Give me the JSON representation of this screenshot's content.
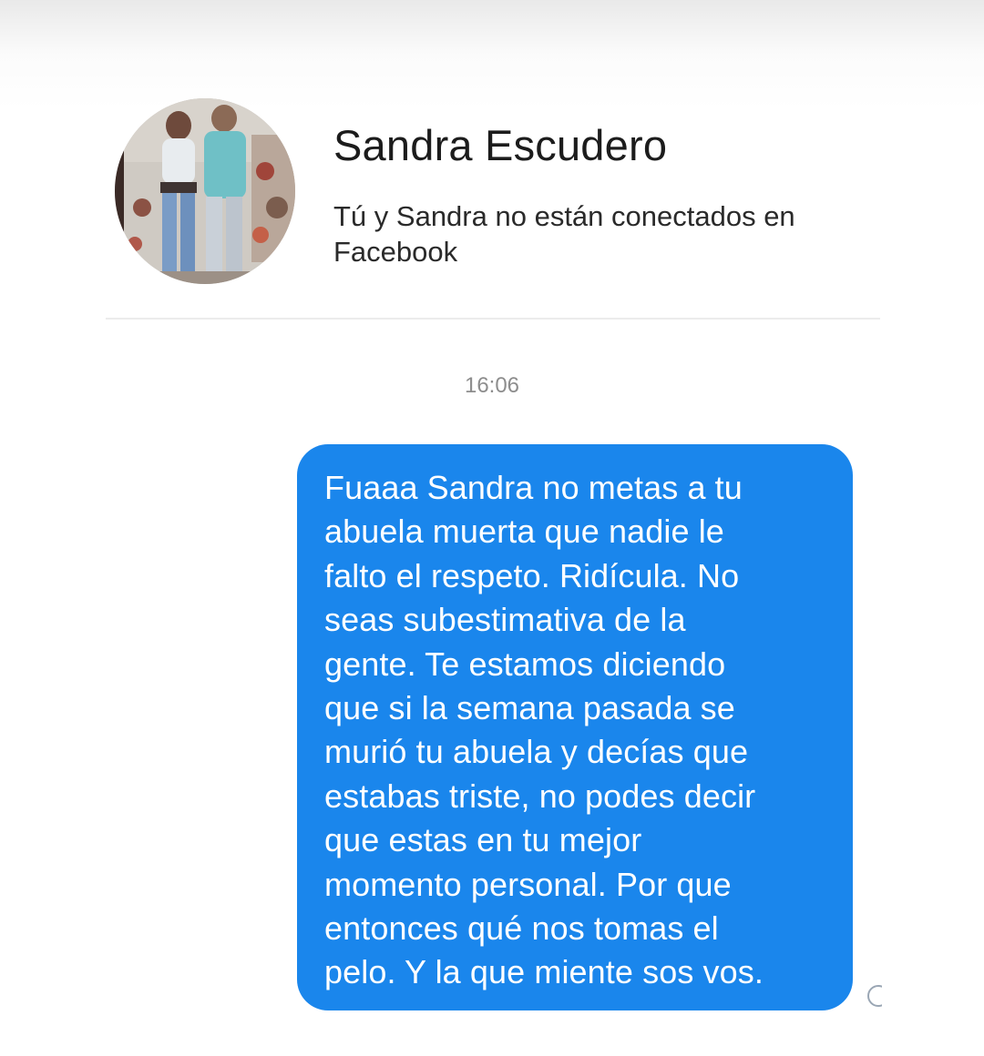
{
  "contact": {
    "name": "Sandra Escudero",
    "status": "Tú y Sandra no están conectados en Facebook"
  },
  "conversation": {
    "timestamp": "16:06",
    "messages": [
      {
        "direction": "outgoing",
        "text": "Fuaaa Sandra    no metas a tu\nabuela muerta que nadie le\nfalto el respeto. Ridícula. No\nseas subestimativa de la\ngente. Te estamos diciendo\nque si la semana pasada se\nmurió tu abuela y decías que\nestabas triste, no podes decir\nque estas en tu mejor\nmomento personal. Por que\nentonces qué nos tomas el\npelo. Y la que miente sos vos."
      }
    ]
  },
  "colors": {
    "bubble": "#1a86ec",
    "bubble_text": "#ffffff",
    "timestamp": "#8d8d8d"
  }
}
